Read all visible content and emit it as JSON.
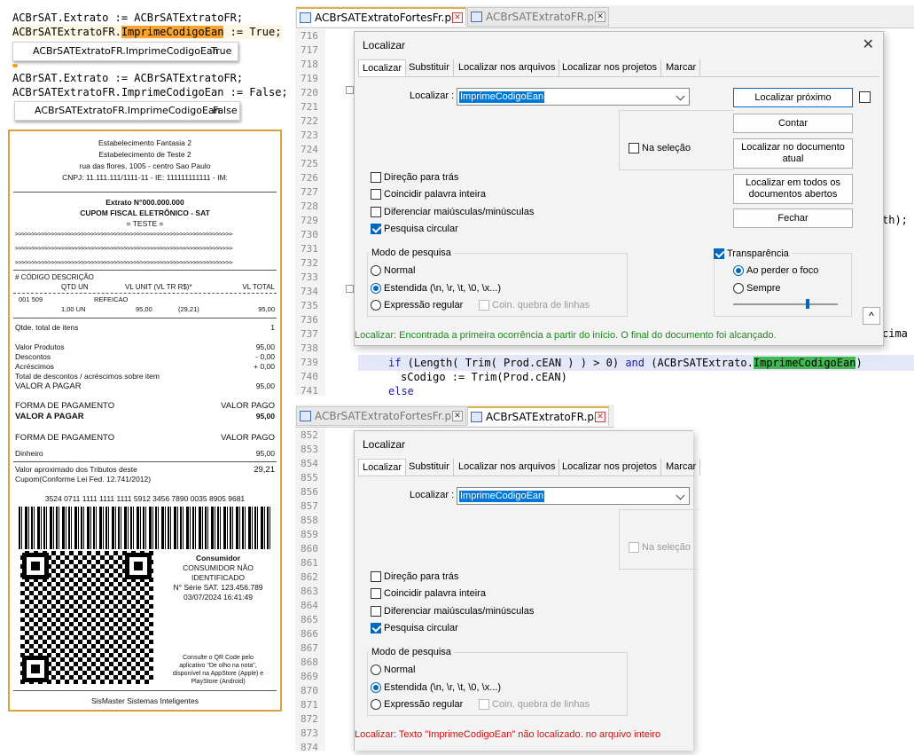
{
  "code_top": {
    "line1": "ACBrSAT.Extrato := ACBrSATExtratoFR;",
    "line2_pre": "ACBrSATExtratoFR.",
    "line2_hl": "ImprimeCodigoEan",
    "line2_post": " := True;",
    "hint1_name": "ACBrSATExtratoFR.ImprimeCodigoEan",
    "hint1_value": "True",
    "line3": "ACBrSAT.Extrato := ACBrSATExtratoFR;",
    "line4": "ACBrSATExtratoFR.ImprimeCodigoEan := False;",
    "hint2_name": "ACBrSATExtratoFR.ImprimeCodigoEan",
    "hint2_value": "False"
  },
  "receipt": {
    "header": [
      "Estabelecimento Fantasia 2",
      "Estabelecimento de Teste 2",
      "rua das flores, 1005 - centro Sao Paulo",
      "CNPJ: 11.111.111/1111-11 - IE: 111111111111 - IM:"
    ],
    "extrato": "Extrato N°000.000.000",
    "cupom": "CUPOM FISCAL ELETRÔNICO - SAT",
    "teste": "=   TESTE   =",
    "gt": ">>>>>>>>>>>>>>>>>>>>>>>>>>>>>>>>>>>>>>>>>>>>>>>>>>>>>>>>>>>>>>>>>>",
    "items_h1": "#      CÓDIGO    DESCRIÇÃO",
    "items_h2": "QTD  UN",
    "items_h3": "VL UNIT    (VL TR R$)*",
    "items_h4": "VL TOTAL",
    "item_a": "001    509",
    "item_b": "REFEICAO",
    "item_c": "1,00 UN",
    "item_d": "95,00",
    "item_e": "(29,21)",
    "item_f": "95,00",
    "qtde_label": "Qtde. total de itens",
    "qtde_value": "1",
    "valor_produtos": "Valor Produtos",
    "valor_produtos_v": "95,00",
    "descontos": "Descontos",
    "descontos_v": "- 0,00",
    "acrescimos": "Acréscimos",
    "acrescimos_v": "+ 0,00",
    "total_desc": "Total de descontos / acréscimos sobre item",
    "valor_pagar": "VALOR A PAGAR",
    "valor_pagar_v": "95,00",
    "forma1": "FORMA DE PAGAMENTO",
    "valor_pago1": "VALOR PAGO",
    "valor_pagar2": "VALOR A PAGAR",
    "valor_pagar2_v": "95,00",
    "forma2": "FORMA DE PAGAMENTO",
    "valor_pago2": "VALOR PAGO",
    "dinheiro": "Dinheiro",
    "dinheiro_v": "95,00",
    "tributos1": "Valor aproximado dos Tributos deste",
    "tributos2": "Cupom(Conforme Lei Fed. 12.741/2012)",
    "tributos_v": "29,21",
    "chave": "3524 0711 1111 1111 1111 5912 3456 7890 0035 8905 9681",
    "consumidor": "Consumidor",
    "consumidor2": "CONSUMIDOR NÃO",
    "consumidor3": "IDENTIFICADO",
    "serie": "N° Série SAT. 123.456.789",
    "data": "03/07/2024 16:41:49",
    "consulte": [
      "Consulte o QR Code pelo",
      "aplicativo \"De olho na nota\",",
      "disponível na AppStore (Apple) e",
      "PlayStore (Android)"
    ],
    "footer": "SisMaster Sistemas Inteligentes"
  },
  "editor1": {
    "tab1": "ACBrSATExtratoFortesFr.pas",
    "tab2": "ACBrSATExtratoFR.pas",
    "lines": [
      "716",
      "717",
      "718",
      "719",
      "720",
      "721",
      "722",
      "723",
      "724",
      "725",
      "726",
      "727",
      "728",
      "729",
      "730",
      "731",
      "732",
      "733",
      "734",
      "735",
      "736",
      "737",
      "738",
      "739",
      "740",
      "741"
    ],
    "frag_729": "th);",
    "frag_737": "cima",
    "line739_a": "if",
    "line739_b": " (Length( Trim( Prod.cEAN ) ) > 0) ",
    "line739_c": "and",
    "line739_d": " (ACBrSATExtrato.",
    "line739_e": "ImprimeCodigoEan",
    "line739_f": ")",
    "line740": "sCodigo := Trim(Prod.cEAN)",
    "line741": "else"
  },
  "dialog1": {
    "title": "Localizar",
    "tabs": [
      "Localizar",
      "Substituir",
      "Localizar nos arquivos",
      "Localizar nos projetos",
      "Marcar"
    ],
    "find_label": "Localizar :",
    "find_value": "ImprimeCodigoEan",
    "btn_next": "Localizar próximo",
    "btn_count": "Contar",
    "btn_find_doc": "Localizar no documento atual",
    "btn_find_all": "Localizar em todos os documentos abertos",
    "btn_close": "Fechar",
    "in_selection": "Na seleção",
    "opt_backward": "Direção para trás",
    "opt_whole": "Coincidir palavra inteira",
    "opt_case": "Diferenciar maiúsculas/minúsculas",
    "opt_wrap": "Pesquisa circular",
    "mode_label": "Modo de pesquisa",
    "mode_normal": "Normal",
    "mode_ext": "Estendida  (\\n, \\r, \\t, \\0, \\x...)",
    "mode_regex": "Expressão regular",
    "dot_newline": "Coin. quebra de linhas",
    "transparency": "Transparência",
    "on_lose_focus": "Ao perder o foco",
    "always": "Sempre",
    "status": "Localizar: Encontrada a primeira ocorrência a partir do início. O final do documento foi alcançado.",
    "status_color": "#1a8a1a"
  },
  "editor2": {
    "tab1": "ACBrSATExtratoFortesFr.pas",
    "tab2": "ACBrSATExtratoFR.pas",
    "lines": [
      "852",
      "853",
      "854",
      "855",
      "856",
      "857",
      "858",
      "859",
      "860",
      "861",
      "862",
      "863",
      "864",
      "865",
      "866",
      "867",
      "868",
      "869",
      "870",
      "871",
      "872",
      "873",
      "874"
    ]
  },
  "dialog2": {
    "title": "Localizar",
    "tabs": [
      "Localizar",
      "Substituir",
      "Localizar nos arquivos",
      "Localizar nos projetos",
      "Marcar"
    ],
    "find_label": "Localizar :",
    "find_value": "ImprimeCodigoEan",
    "in_selection": "Na seleção",
    "opt_backward": "Direção para trás",
    "opt_whole": "Coincidir palavra inteira",
    "opt_case": "Diferenciar maiúsculas/minúsculas",
    "opt_wrap": "Pesquisa circular",
    "mode_label": "Modo de pesquisa",
    "mode_normal": "Normal",
    "mode_ext": "Estendida  (\\n, \\r, \\t, \\0, \\x...)",
    "mode_regex": "Expressão regular",
    "dot_newline": "Coin. quebra de linhas",
    "status": "Localizar: Texto \"ImprimeCodigoEan\" não localizado. no arquivo inteiro",
    "status_color": "#d01010"
  }
}
